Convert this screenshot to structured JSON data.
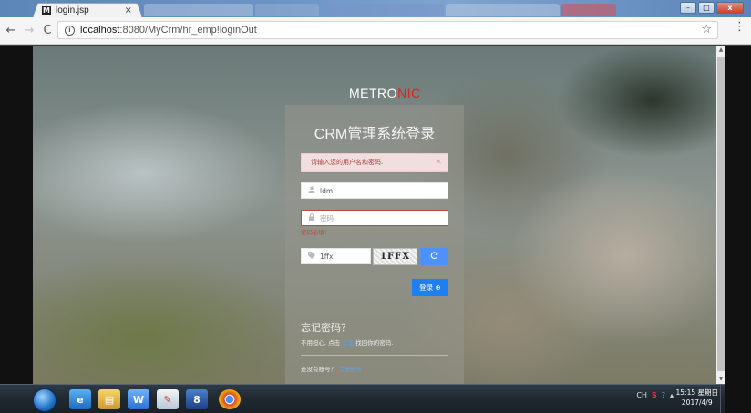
{
  "browser": {
    "tab_title": "login.jsp",
    "tab_favicon": "M",
    "tab_close": "×",
    "url_host": "localhost",
    "url_path": ":8080/MyCrm/hr_emp!loginOut",
    "back": "←",
    "forward": "→",
    "reload": "C",
    "bookmark_icon": "☆",
    "menu_icon": "⋮",
    "window_buttons": {
      "minimize": "–",
      "maximize": "□",
      "close": "x"
    }
  },
  "page": {
    "logo_prefix": "METRO",
    "logo_suffix": "NIC",
    "title": "CRM管理系统登录",
    "alert": "请输入您的用户名和密码.",
    "alert_close": "×",
    "username": {
      "value": "ldm"
    },
    "password": {
      "placeholder": "密码"
    },
    "password_help": "密码必填!",
    "captcha": {
      "value": "1ffx",
      "image_text": "1FFX"
    },
    "login_button": "登录 ⊕",
    "forget_title": "忘记密码？",
    "forget_text_before": "不用担心, 点击 ",
    "forget_link": "这里",
    "forget_text_after": " 找回你的密码.",
    "register_text": "还没有账号？",
    "register_link": "注册账号"
  },
  "taskbar": {
    "clock_time": "15:15 星期日",
    "clock_date": "2017/4/9",
    "tray": [
      "CH",
      "S",
      "?"
    ]
  },
  "colors": {
    "accent": "#1e7ff5",
    "refresh": "#4d90fe",
    "alert_bg": "#f2dede",
    "alert_text": "#a94442",
    "error": "#b94a48",
    "logo_red": "#e02222"
  }
}
